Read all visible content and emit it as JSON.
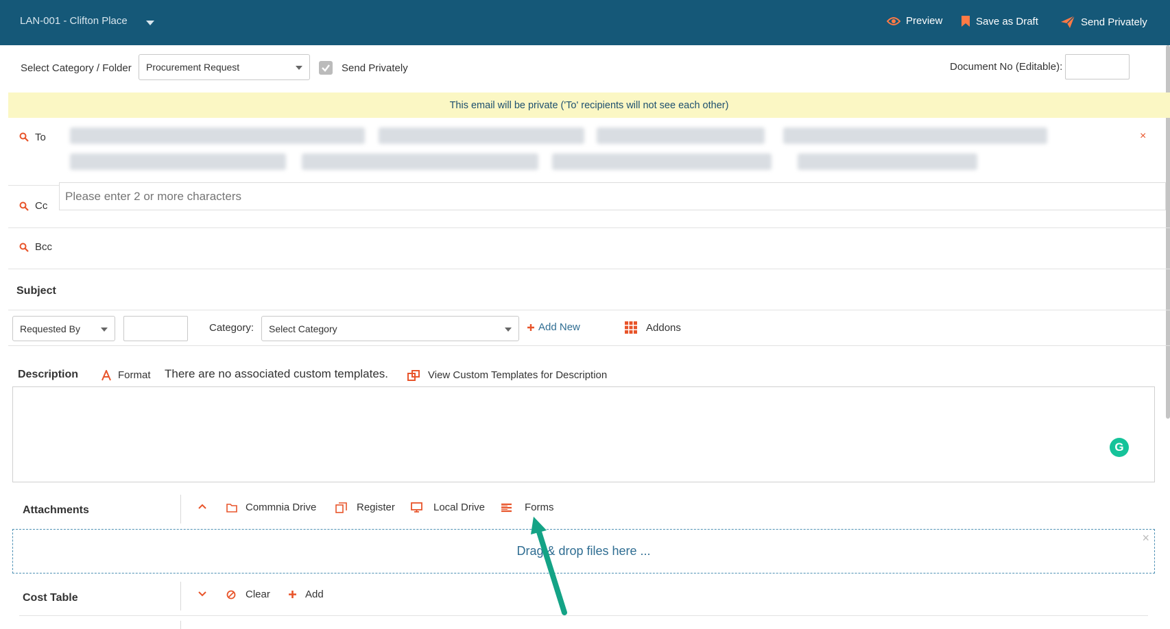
{
  "header": {
    "project_title": "LAN-001 - Clifton Place",
    "preview_label": "Preview",
    "save_draft_label": "Save as Draft",
    "send_privately_label": "Send Privately"
  },
  "row1": {
    "category_label": "Select Category / Folder",
    "category_value": "Procurement Request",
    "send_privately_checkbox_label": "Send Privately",
    "doc_no_label": "Document No (Editable):",
    "doc_no_value": ""
  },
  "notice": {
    "text": "This email will be private ('To' recipients will not see each other)"
  },
  "recipients": {
    "to_label": "To",
    "cc_label": "Cc",
    "cc_placeholder": "Please enter 2 or more characters",
    "bcc_label": "Bcc",
    "clear_symbol": "×"
  },
  "subject": {
    "label": "Subject"
  },
  "filters": {
    "requested_by_value": "Requested By",
    "requested_by_input_value": "",
    "category_label": "Category:",
    "category_value": "Select Category",
    "add_new_label": "Add New",
    "addons_label": "Addons"
  },
  "description": {
    "label": "Description",
    "format_label": "Format",
    "no_templates_text": "There are no associated custom templates.",
    "view_templates_label": "View Custom Templates for Description",
    "grammarly_letter": "G"
  },
  "attachments": {
    "label": "Attachments",
    "commnia_drive_label": "Commnia Drive",
    "register_label": "Register",
    "local_drive_label": "Local Drive",
    "forms_label": "Forms",
    "dropzone_text": "Drag & drop files here ...",
    "dropzone_close": "×"
  },
  "cost_table": {
    "label": "Cost Table",
    "clear_label": "Clear",
    "add_label": "Add"
  },
  "colors": {
    "header_bg": "#155878",
    "accent": "#e8542a",
    "notice_bg": "#fbf7c4",
    "link_blue": "#2f6d92",
    "annotation_arrow": "#14a386",
    "grammarly": "#15c39a"
  },
  "icons": [
    "eye-icon",
    "bookmark-icon",
    "paper-plane-icon",
    "search-icon",
    "checkbox-icon",
    "plus-icon",
    "grid-icon",
    "font-icon",
    "template-icon",
    "chevron-up-icon",
    "folder-icon",
    "register-icon",
    "monitor-icon",
    "forms-icon",
    "ban-icon",
    "chevron-down-icon"
  ]
}
